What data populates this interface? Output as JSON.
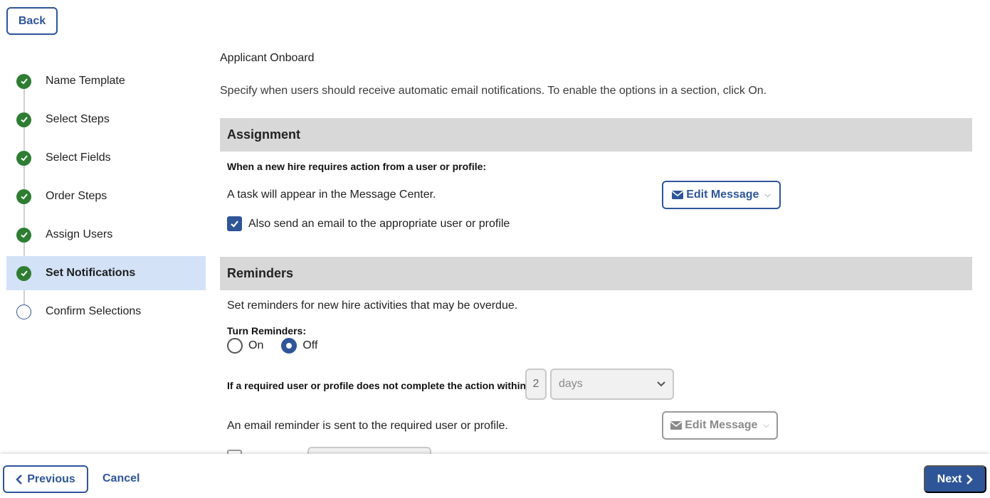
{
  "header": {
    "back_label": "Back"
  },
  "steps": [
    {
      "label": "Name Template",
      "status": "done"
    },
    {
      "label": "Select Steps",
      "status": "done"
    },
    {
      "label": "Select Fields",
      "status": "done"
    },
    {
      "label": "Order Steps",
      "status": "done"
    },
    {
      "label": "Assign Users",
      "status": "done"
    },
    {
      "label": "Set Notifications",
      "status": "done",
      "active": true
    },
    {
      "label": "Confirm Selections",
      "status": "todo"
    }
  ],
  "main": {
    "title": "Applicant Onboard",
    "intro": "Specify when users should receive automatic email notifications. To enable the options in a section, click On.",
    "assignment": {
      "header": "Assignment",
      "subheading": "When a new hire requires action from a user or profile:",
      "task_text": "A task will appear in the Message Center.",
      "edit_label": "Edit Message",
      "email_checkbox_label": "Also send an email to the appropriate user or profile",
      "email_checked": true
    },
    "reminders": {
      "header": "Reminders",
      "description": "Set reminders for new hire activities that may be overdue.",
      "turn_label": "Turn Reminders:",
      "on_label": "On",
      "off_label": "Off",
      "selected": "Off",
      "within_label": "If a required user or profile does not complete the action within:",
      "within_value": "2",
      "unit_value": "days",
      "email_text": "An email reminder is sent to the required user or profile.",
      "edit_label": "Edit Message"
    }
  },
  "footer": {
    "previous_label": "Previous",
    "cancel_label": "Cancel",
    "next_label": "Next"
  },
  "colors": {
    "accent": "#2f5599",
    "done": "#2e7d32",
    "active_row": "#d3e2f6",
    "section_bg": "#d8d8d8"
  }
}
